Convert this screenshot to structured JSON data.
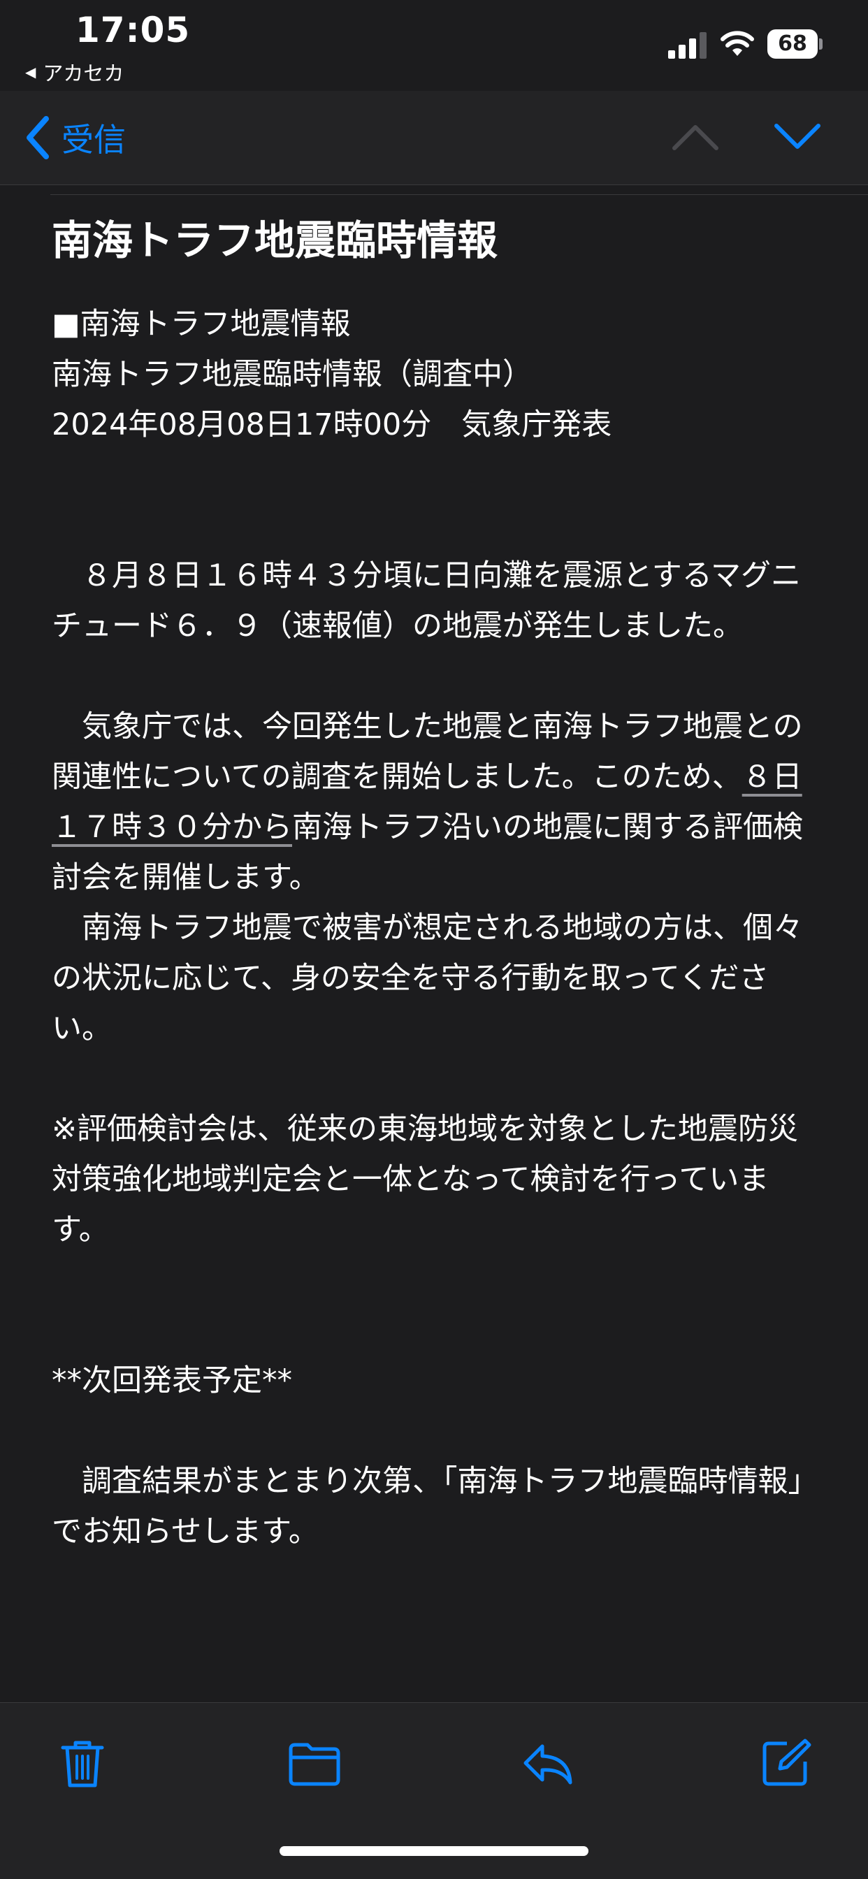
{
  "status_bar": {
    "time": "17:05",
    "back_app": "アカセカ",
    "battery_level": "68"
  },
  "nav": {
    "back_label": "受信"
  },
  "message": {
    "subject": "南海トラフ地震臨時情報",
    "header_lines": [
      "■南海トラフ地震情報",
      "南海トラフ地震臨時情報（調査中）",
      "2024年08月08日17時00分　気象庁発表"
    ],
    "para1": "　８月８日１６時４３分頃に日向灘を震源とするマグニチュード６．９（速報値）の地震が発生しました。",
    "para2_before": "　気象庁では、今回発生した地震と南海トラフ地震との関連性についての調査を開始しました。このため、",
    "para2_link": "８日１７時３０分から",
    "para2_after": "南海トラフ沿いの地震に関する評価検討会を開催します。",
    "para3": "　南海トラフ地震で被害が想定される地域の方は、個々の状況に応じて、身の安全を守る行動を取ってください。",
    "para4": "※評価検討会は、従来の東海地域を対象とした地震防災対策強化地域判定会と一体となって検討を行っています。",
    "next_heading": "**次回発表予定**",
    "para5": "　調査結果がまとまり次第、「南海トラフ地震臨時情報」でお知らせします。"
  },
  "toolbar": {
    "icons": [
      "trash-icon",
      "folder-icon",
      "reply-icon",
      "compose-icon"
    ]
  },
  "colors": {
    "background": "#1c1c1e",
    "bar_background": "#232325",
    "accent": "#0a84ff",
    "text": "#ffffff"
  }
}
